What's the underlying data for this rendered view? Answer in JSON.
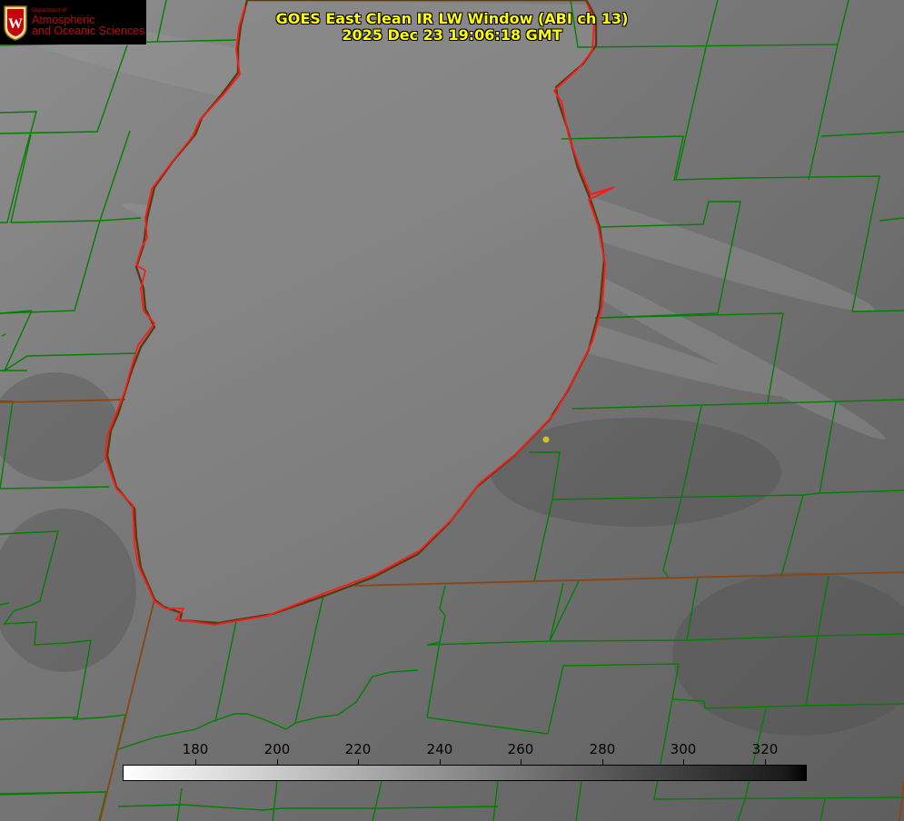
{
  "header": {
    "title_line_1": "GOES East Clean IR LW Window (ABI ch 13)",
    "title_line_2": "2025 Dec 23 19:06:18 GMT"
  },
  "logo": {
    "dept": "Department of",
    "name_line_1": "Atmospheric",
    "name_line_2": "and Oceanic Sciences",
    "crest_letter": "W",
    "color": "#c5050c"
  },
  "colorbar": {
    "ticks": [
      "180",
      "200",
      "220",
      "240",
      "260",
      "280",
      "300",
      "320"
    ]
  },
  "colors": {
    "title": "#ffff00",
    "lake_outline": "#ff0000",
    "county_lines": "#008000",
    "state_lines": "#8b4513",
    "marker": "#d4c020"
  },
  "icons": [
    "university-crest-icon",
    "location-marker-icon"
  ]
}
